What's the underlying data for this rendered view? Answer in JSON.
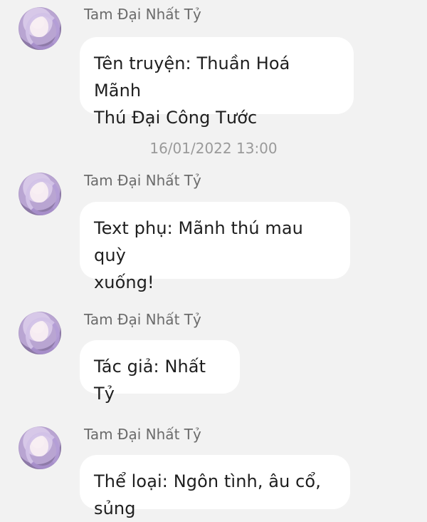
{
  "messages": [
    {
      "sender": "Tam Đại Nhất Tỷ",
      "text": "Tên truyện: Thuần Hoá Mãnh\nThú Đại Công Tước"
    },
    {
      "sender": "Tam Đại Nhất Tỷ",
      "text": "Text phụ: Mãnh thú mau quỳ\nxuống!"
    },
    {
      "sender": "Tam Đại Nhất Tỷ",
      "text": "Tác giả: Nhất Tỷ"
    },
    {
      "sender": "Tam Đại Nhất Tỷ",
      "text": "Thể loại: Ngôn tình, âu cổ, sủng"
    }
  ],
  "timestamp": "16/01/2022 13:00",
  "colors": {
    "background": "#f2f2f2",
    "bubble": "#ffffff",
    "sender": "#6b6b6b",
    "timestamp": "#9a9a9a",
    "text": "#1e1e1e"
  }
}
